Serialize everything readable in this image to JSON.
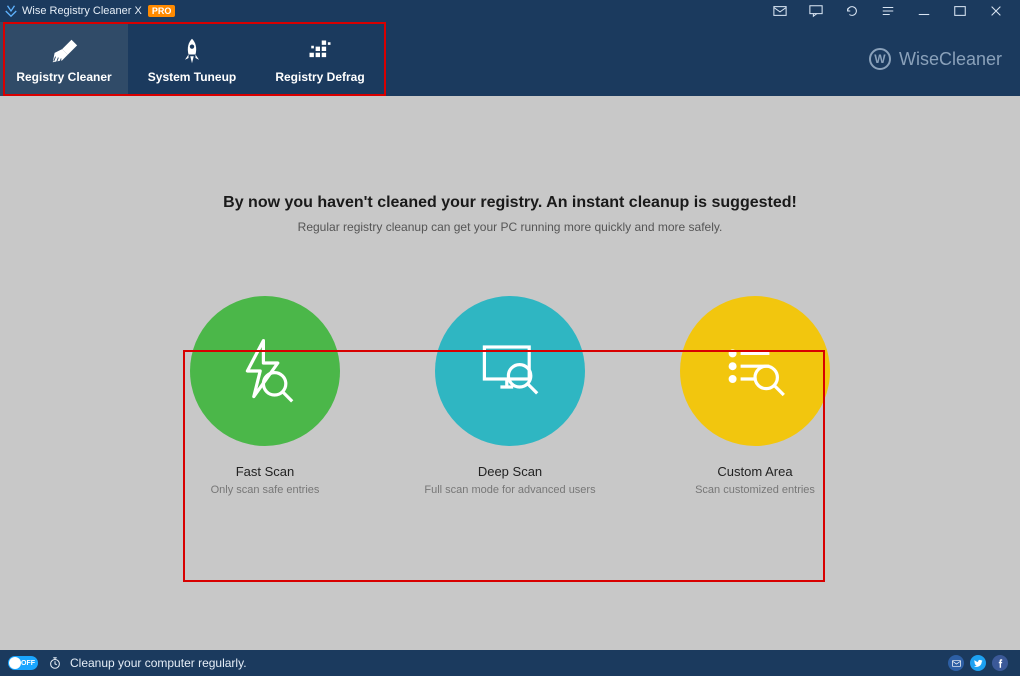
{
  "app": {
    "title": "Wise Registry Cleaner X",
    "badge": "PRO",
    "brand": "WiseCleaner",
    "brand_initial": "W"
  },
  "tabs": [
    {
      "label": "Registry Cleaner",
      "active": true
    },
    {
      "label": "System Tuneup",
      "active": false
    },
    {
      "label": "Registry Defrag",
      "active": false
    }
  ],
  "headline": "By now you haven't cleaned your registry. An instant cleanup is suggested!",
  "subhead": "Regular registry cleanup can get your PC running more quickly and more safely.",
  "options": [
    {
      "label": "Fast Scan",
      "desc": "Only scan safe entries"
    },
    {
      "label": "Deep Scan",
      "desc": "Full scan mode for advanced users"
    },
    {
      "label": "Custom Area",
      "desc": "Scan customized entries"
    }
  ],
  "status": {
    "toggle_label": "OFF",
    "message": "Cleanup your computer regularly."
  }
}
